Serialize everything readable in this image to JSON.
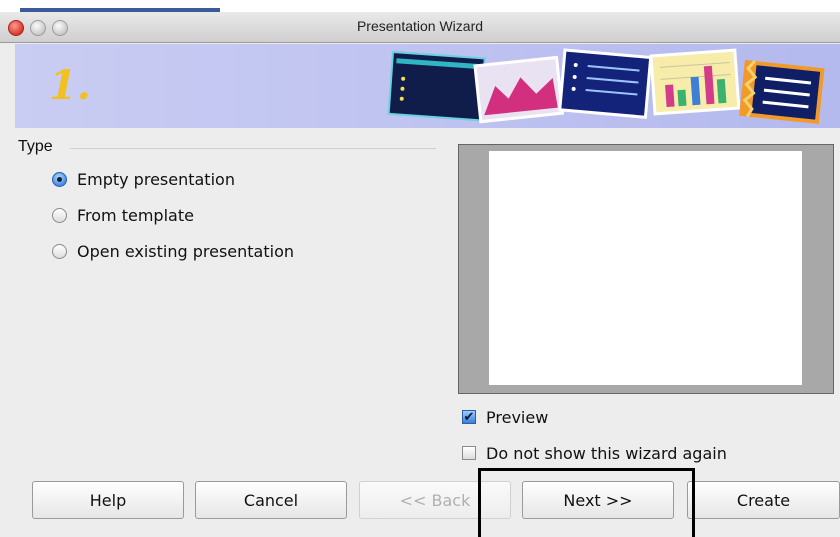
{
  "window": {
    "title": "Presentation Wizard"
  },
  "banner": {
    "step_number": "1."
  },
  "type_group": {
    "label": "Type",
    "options": [
      {
        "label": "Empty presentation",
        "selected": true
      },
      {
        "label": "From template",
        "selected": false
      },
      {
        "label": "Open existing presentation",
        "selected": false
      }
    ]
  },
  "preview": {
    "preview_checkbox": {
      "label": "Preview",
      "checked": true,
      "mark": "✔"
    },
    "dont_show_checkbox": {
      "label": "Do not show this wizard again",
      "checked": false
    }
  },
  "buttons": {
    "help": "Help",
    "cancel": "Cancel",
    "back": "<< Back",
    "next": "Next >>",
    "create": "Create"
  },
  "colors": {
    "banner": "#b4b9ee",
    "step_number": "#f3c024",
    "radio_selected": "#3b86e0",
    "close_button": "#d9372d"
  }
}
